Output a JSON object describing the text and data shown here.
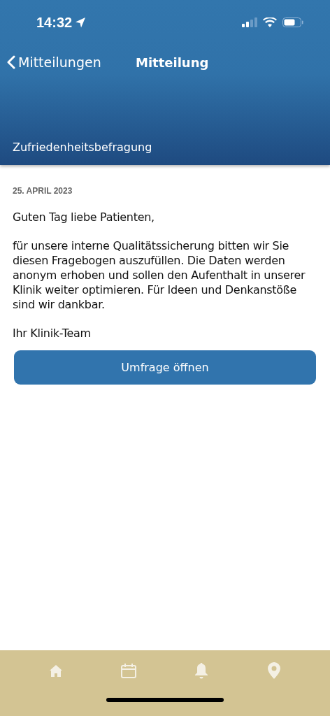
{
  "status_bar": {
    "time": "14:32"
  },
  "nav": {
    "back": "Mitteilungen",
    "title": "Mitteilung",
    "subtitle": "Zufriedenheitsbefragung"
  },
  "message": {
    "date": "25. APRIL 2023",
    "paragraphs": [
      "Guten Tag liebe Patienten,",
      "für unsere interne Qualitätssicherung bitten wir Sie diesen Fragebogen auszufüllen. Die Daten werden anonym erhoben und sollen den Aufenthalt in unserer Klinik weiter optimieren. Für Ideen und Denkanstöße sind wir dankbar.",
      "Ihr Klinik-Team"
    ],
    "button": "Umfrage öffnen"
  },
  "tab_bar": [
    {
      "kind": "home"
    },
    {
      "kind": "calendar"
    },
    {
      "kind": "bell"
    },
    {
      "kind": "pin"
    }
  ]
}
